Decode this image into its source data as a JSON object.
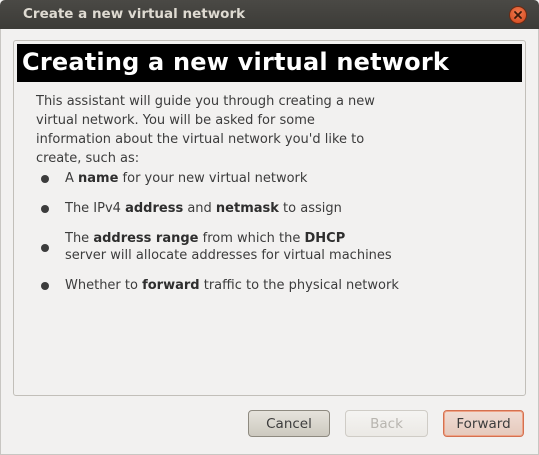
{
  "window": {
    "title": "Create a new virtual network"
  },
  "header": {
    "title": "Creating a new virtual network"
  },
  "intro": {
    "line1": "This assistant will guide you through creating a new",
    "line2": "virtual network. You will be asked for some",
    "line3": "information about the virtual network you'd like to",
    "line4": "create, such as:"
  },
  "bullets": [
    {
      "segments": [
        "A ",
        "name",
        " for your new virtual network"
      ]
    },
    {
      "segments": [
        "The IPv4 ",
        "address",
        " and ",
        "netmask",
        " to assign"
      ]
    },
    {
      "line1": [
        "The ",
        "address range",
        " from which the ",
        "DHCP"
      ],
      "line2": "server will allocate addresses for virtual machines"
    },
    {
      "segments": [
        "Whether to ",
        "forward",
        " traffic to the physical network"
      ]
    }
  ],
  "buttons": {
    "cancel": "Cancel",
    "back": "Back",
    "forward": "Forward"
  },
  "colors": {
    "titlebar": "#3c3b37",
    "close_button": "#e0562a",
    "header_banner": "#000000",
    "forward_focus": "#d47150"
  },
  "icons": {
    "close": "close-icon"
  }
}
